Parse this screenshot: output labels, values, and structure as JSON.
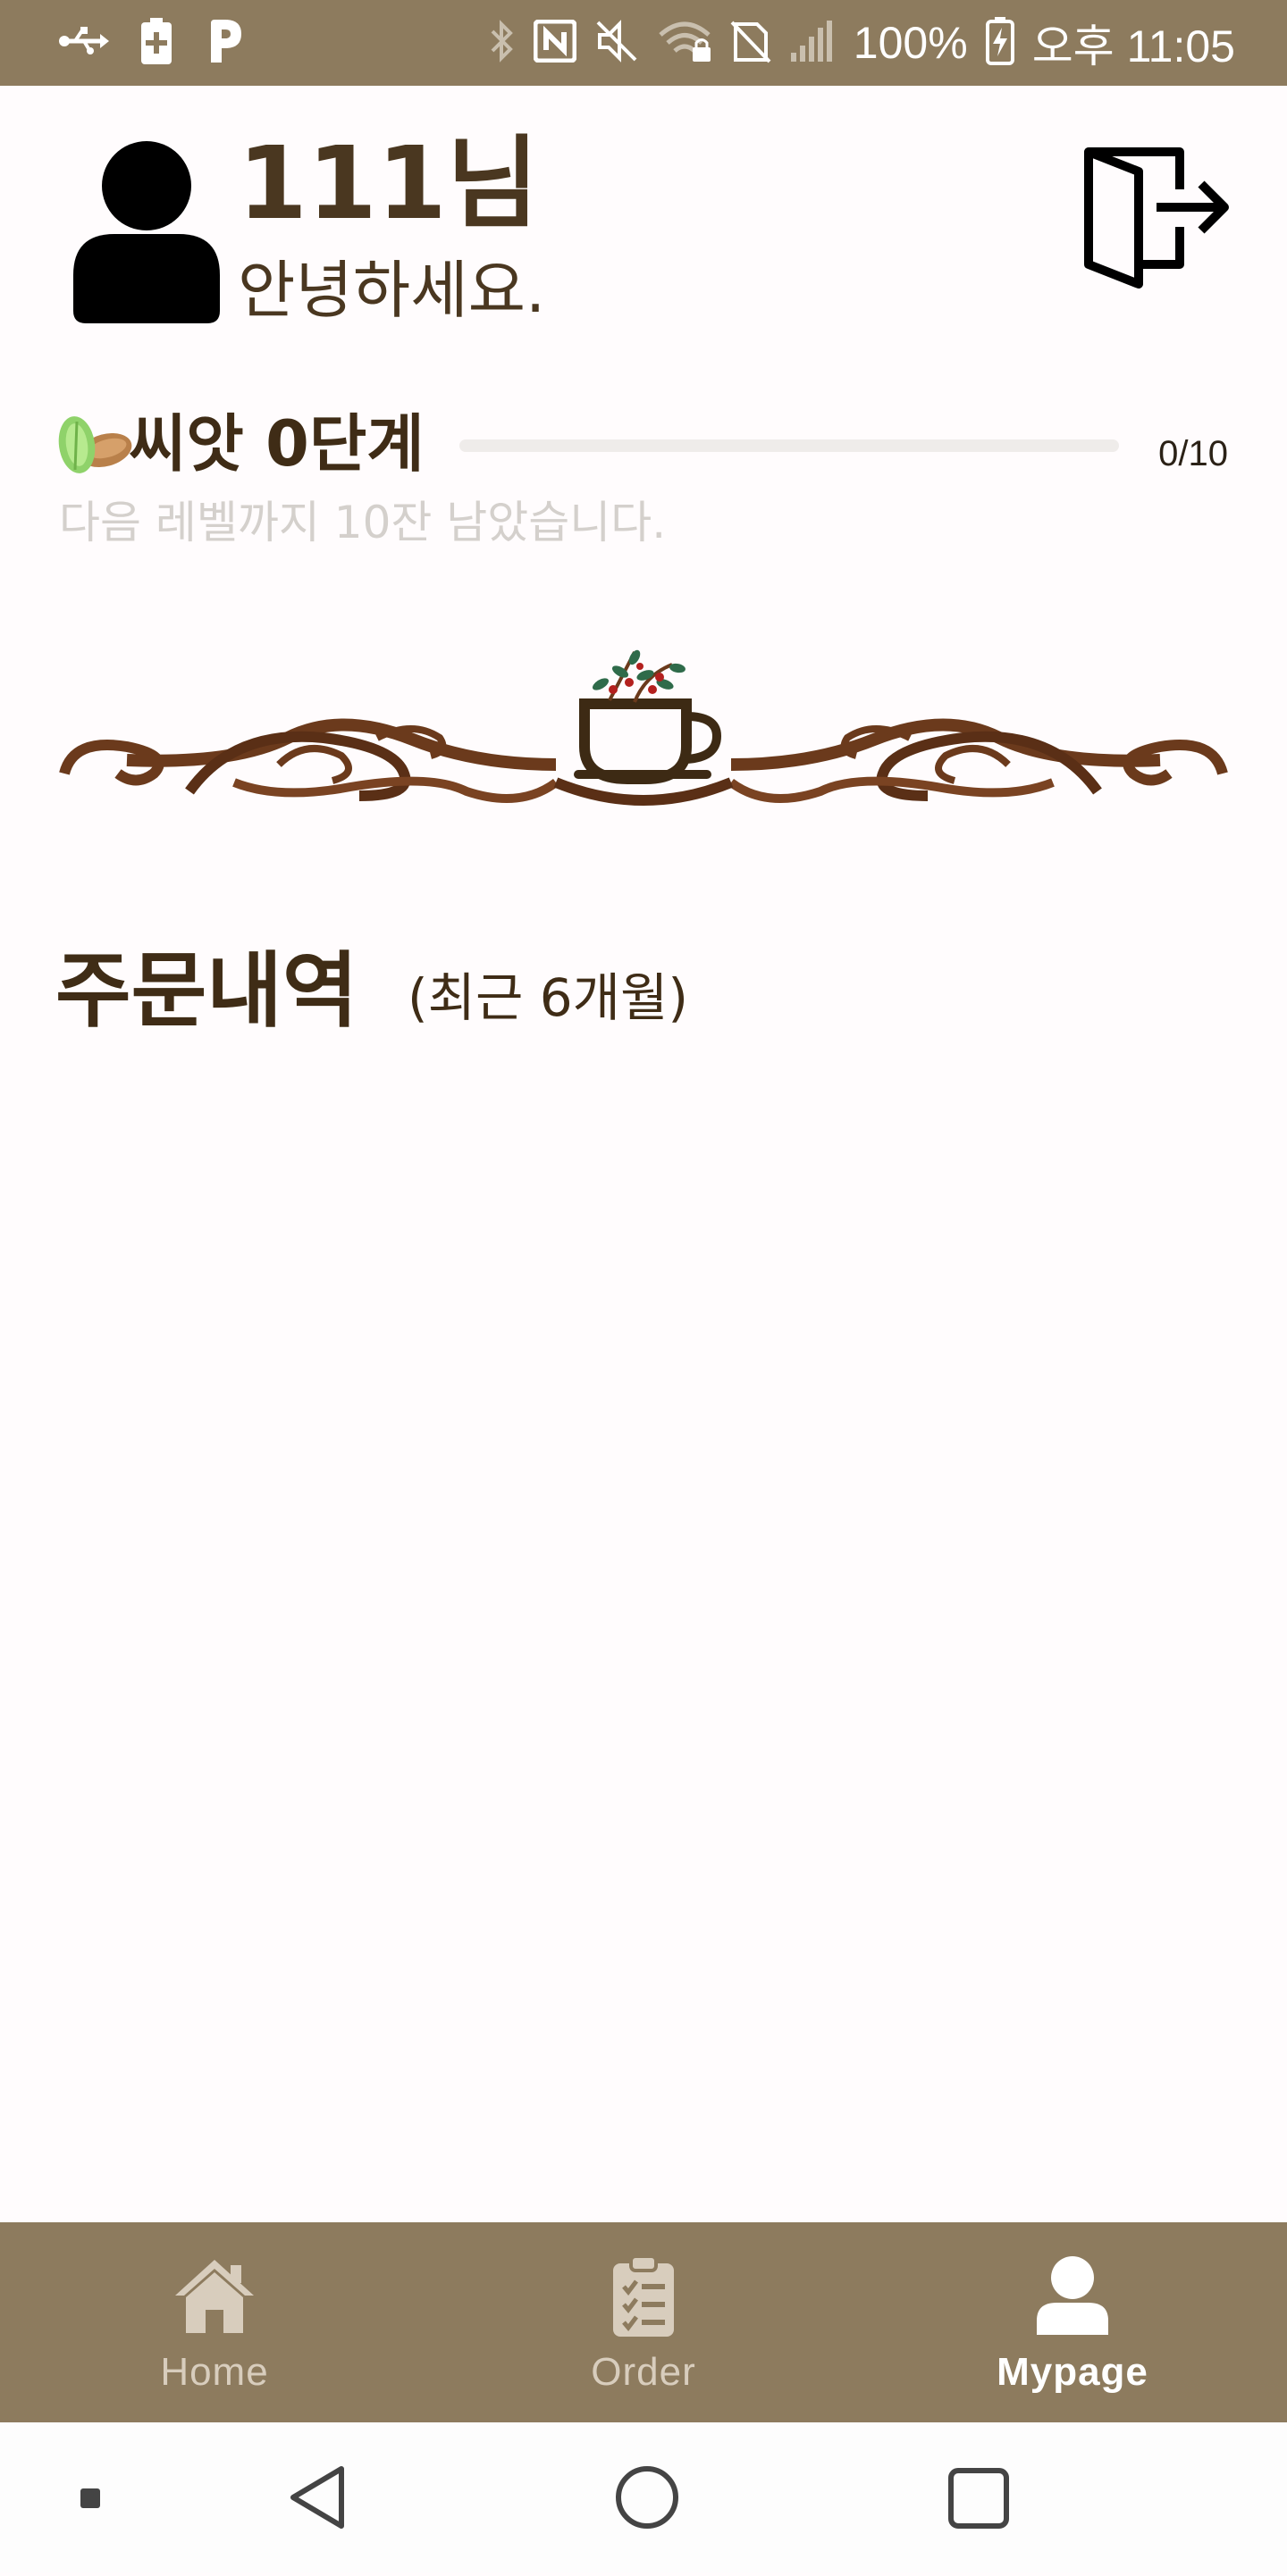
{
  "status_bar": {
    "battery": "100%",
    "time": "오후 11:05",
    "left_icons": [
      "usb-icon",
      "battery-saver-icon",
      "parking-app-icon"
    ],
    "right_icons": [
      "bluetooth-icon",
      "nfc-icon",
      "mute-icon",
      "wifi-icon",
      "no-sim-icon",
      "signal-icon",
      "battery-charging-icon"
    ]
  },
  "header": {
    "user_name": "111님",
    "greeting": "안녕하세요.",
    "logout_icon": "logout-icon"
  },
  "level": {
    "title": "씨앗 0단계",
    "progress_count": "0/10",
    "progress_fraction": 0.0,
    "hint": "다음 레벨까지 10잔 남았습니다.",
    "icon": "seed-icon"
  },
  "orders": {
    "title": "주문내역",
    "subtitle": "(최근 6개월)",
    "items": []
  },
  "bottom_nav": {
    "items": [
      {
        "label": "Home",
        "icon": "home-icon",
        "active": false
      },
      {
        "label": "Order",
        "icon": "clipboard-icon",
        "active": false
      },
      {
        "label": "Mypage",
        "icon": "user-icon",
        "active": true
      }
    ]
  },
  "colors": {
    "brand_brown": "#8d7b5e",
    "text_dark": "#4a3720",
    "hint_gray": "#d4d0cc",
    "background": "#fffcfd"
  }
}
